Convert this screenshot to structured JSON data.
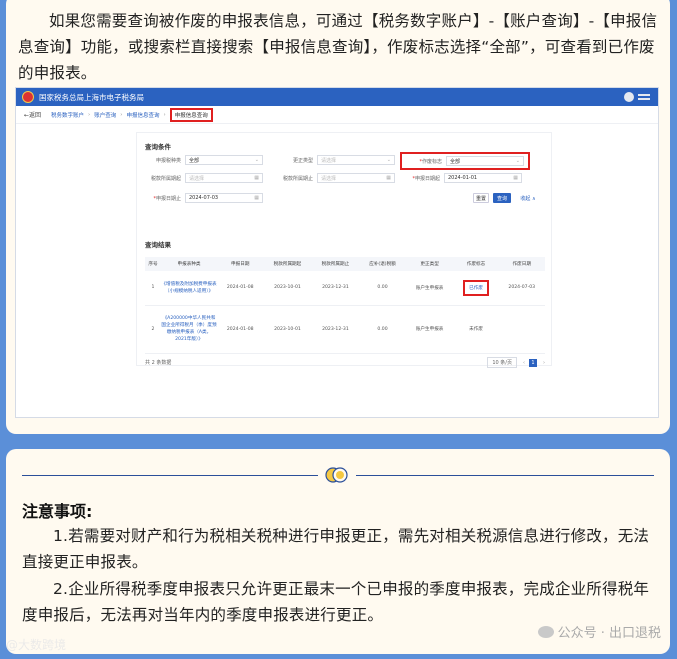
{
  "intro": {
    "text": "如果您需要查询被作废的申报表信息，可通过【税务数字账户】-【账户查询】-【申报信息查询】功能，或搜索栏直接搜索【申报信息查询】，作废标志选择“全部”，可查看到已作废的申报表。"
  },
  "screenshot": {
    "header_title": "国家税务总局上海市电子税务局",
    "back_label": "←返回",
    "breadcrumb": [
      "税务数字账户",
      "账户查询",
      "申报信息查询"
    ],
    "current_tab": "申报信息查询",
    "query_section_title": "查询条件",
    "fields": {
      "tax_kind_label": "申报税种类",
      "tax_kind_value": "全部",
      "correction_type_label": "更正类型",
      "correction_type_placeholder": "请选择",
      "void_flag_label": "作废标志",
      "void_flag_value": "全部",
      "period_start_label": "税款所属期起",
      "period_start_placeholder": "请选择",
      "period_end_label": "税款所属期止",
      "period_end_placeholder": "请选择",
      "declare_start_label": "申报日期起",
      "declare_start_value": "2024-01-01",
      "declare_end_label": "申报日期止",
      "declare_end_value": "2024-07-03"
    },
    "buttons": {
      "reset": "重置",
      "query": "查询",
      "collapse": "收起 ∧"
    },
    "result_section_title": "查询结果",
    "columns": [
      "序号",
      "申报表种类",
      "申报日期",
      "税款所属期起",
      "税款所属期止",
      "应补(退)税额",
      "更正类型",
      "作废标志",
      "作废日期"
    ],
    "rows": [
      {
        "seq": "1",
        "form": "《增值税及附加税费申报表（小规模纳税人适用）》",
        "date": "2024-01-08",
        "start": "2023-10-01",
        "end": "2023-12-31",
        "amount": "0.00",
        "type": "账户生申报表",
        "flag": "已作废",
        "void_date": "2024-07-03"
      },
      {
        "seq": "2",
        "form": "《A200000中华人民共和国企业所得税月（季）度预缴纳税申报表（A类，2021年版）》",
        "date": "2024-01-08",
        "start": "2023-10-01",
        "end": "2023-12-31",
        "amount": "0.00",
        "type": "账户生申报表",
        "flag": "未作废",
        "void_date": ""
      }
    ],
    "pager": {
      "total": "共 2 条数据",
      "page_size": "10 条/页",
      "prev": "‹",
      "current_page": "1",
      "next": "›"
    }
  },
  "notes": {
    "title": "注意事项:",
    "items": [
      "1.若需要对财产和行为税相关税种进行申报更正，需先对相关税源信息进行修改，无法直接更正申报表。",
      "2.企业所得税季度申报表只允许更正最末一个已申报的季度申报表，完成企业所得税年度申报后，无法再对当年内的季度申报表进行更正。"
    ]
  },
  "watermark": {
    "right": "公众号 · 出口退税",
    "left": "@大数跨境"
  },
  "colors": {
    "background": "#5b8fd8",
    "card": "#fffaf0",
    "accent": "#2b62c0",
    "highlight": "#e02020"
  }
}
